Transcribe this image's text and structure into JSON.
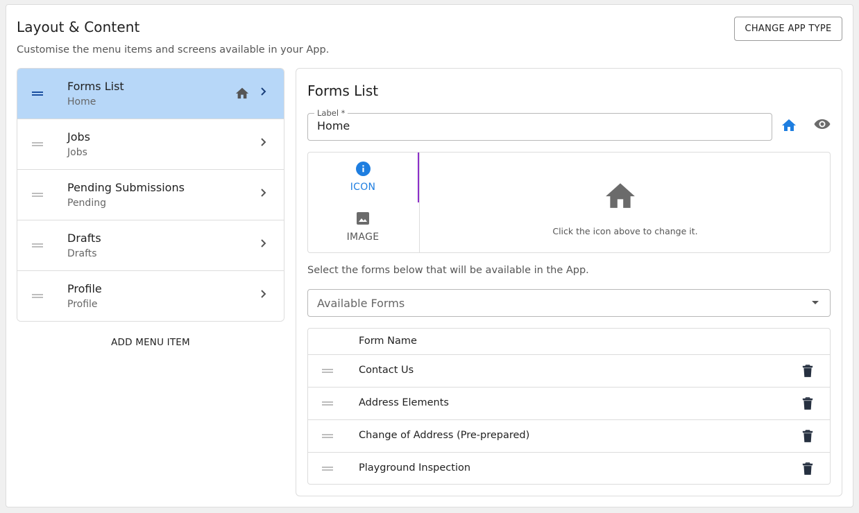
{
  "header": {
    "title": "Layout & Content",
    "subtitle": "Customise the menu items and screens available in your App.",
    "change_app_type": "CHANGE APP TYPE"
  },
  "menu": {
    "items": [
      {
        "title": "Forms List",
        "subtitle": "Home",
        "selected": true,
        "icon": "home-icon"
      },
      {
        "title": "Jobs",
        "subtitle": "Jobs",
        "selected": false
      },
      {
        "title": "Pending Submissions",
        "subtitle": "Pending",
        "selected": false
      },
      {
        "title": "Drafts",
        "subtitle": "Drafts",
        "selected": false
      },
      {
        "title": "Profile",
        "subtitle": "Profile",
        "selected": false
      }
    ],
    "add_label": "ADD MENU ITEM"
  },
  "detail": {
    "title": "Forms List",
    "label_legend": "Label *",
    "label_value": "Home",
    "tabs": [
      {
        "label": "ICON",
        "icon": "info-icon",
        "active": true
      },
      {
        "label": "IMAGE",
        "icon": "image-icon",
        "active": false
      }
    ],
    "icon_hint": "Click the icon above to change it.",
    "forms_hint": "Select the forms below that will be available in the App.",
    "available_forms_placeholder": "Available Forms",
    "table": {
      "header": "Form Name",
      "rows": [
        "Contact Us",
        "Address Elements",
        "Change of Address (Pre-prepared)",
        "Playground Inspection"
      ]
    }
  },
  "colors": {
    "accent": "#1e7ee0",
    "selected_bg": "#b7d7f8",
    "tab_indicator": "#8b2fc9"
  }
}
